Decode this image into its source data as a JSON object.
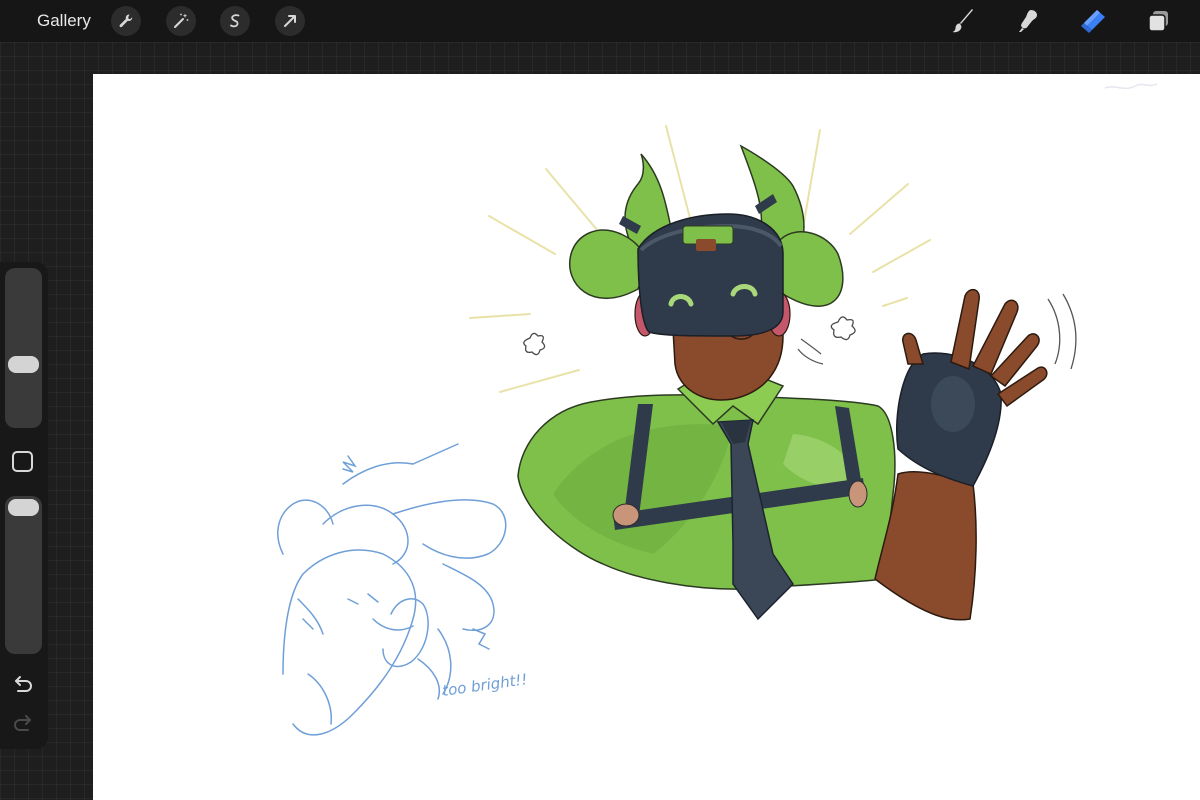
{
  "topbar": {
    "gallery_label": "Gallery",
    "left_tools": [
      "wrench-icon",
      "magic-wand-icon",
      "selection-icon",
      "transform-arrow-icon"
    ],
    "right_tools": [
      "brush-icon",
      "smudge-icon",
      "eraser-icon",
      "layers-icon"
    ],
    "active_tool": "eraser",
    "accent_color": "#3a7ff6"
  },
  "sidebar": {
    "brush_size_level": 0.62,
    "opacity_level": 0.0,
    "undo_icon": "undo-arrow-icon",
    "redo_icon": "redo-arrow-icon"
  },
  "canvas": {
    "sketch_note": "too bright!!",
    "colors": {
      "outfit_green": "#7fc04a",
      "mask_navy": "#2f3a4a",
      "skin_brown": "#8a4a2c",
      "sketch_blue": "#6f9fd8",
      "sparkle_yellow": "#e9e2a8"
    }
  }
}
